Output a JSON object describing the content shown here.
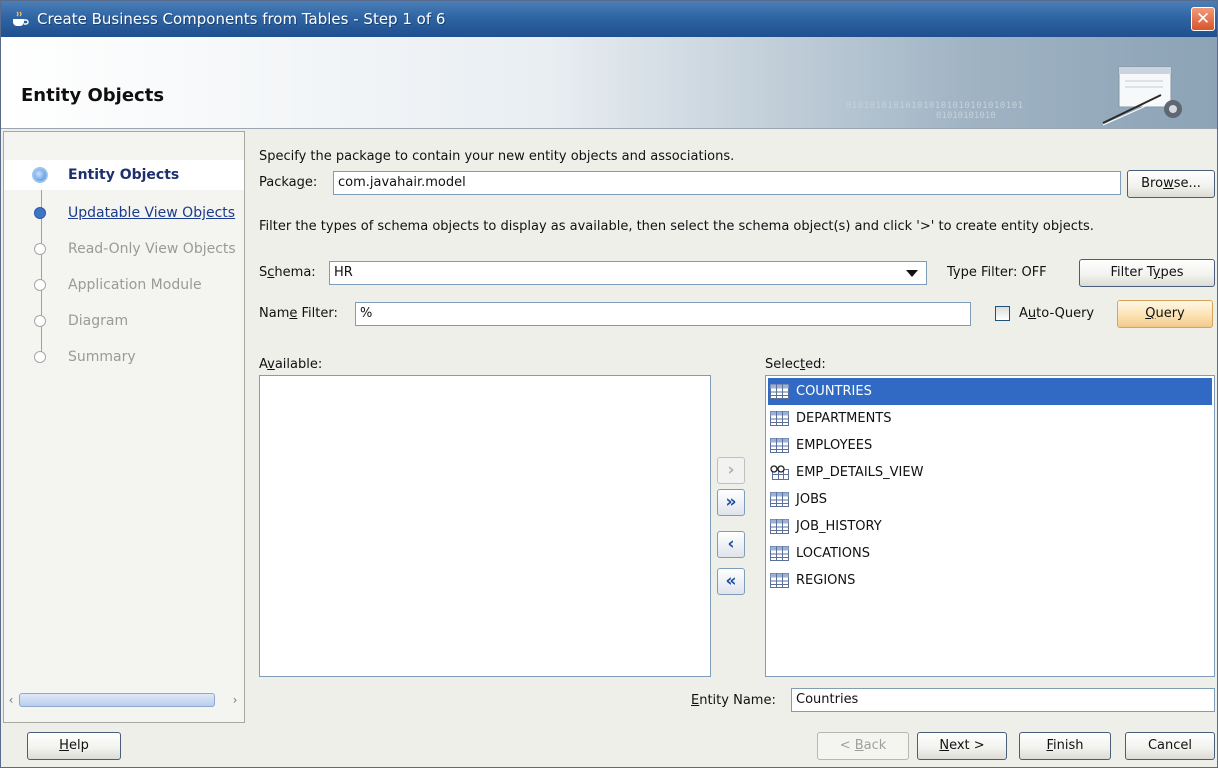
{
  "window": {
    "title": "Create Business Components from Tables - Step 1 of 6",
    "close_glyph": "✕"
  },
  "header": {
    "heading": "Entity Objects",
    "binary_line1": "010101010101010101010101010101",
    "binary_line2": "01010101010"
  },
  "nav": {
    "items": [
      {
        "label": "Entity Objects",
        "state": "active"
      },
      {
        "label": "Updatable View Objects",
        "state": "link"
      },
      {
        "label": "Read-Only View Objects",
        "state": "disabled"
      },
      {
        "label": "Application Module",
        "state": "disabled"
      },
      {
        "label": "Diagram",
        "state": "disabled"
      },
      {
        "label": "Summary",
        "state": "disabled"
      }
    ],
    "scroll_left": "‹",
    "scroll_right": "›"
  },
  "main": {
    "package_instruction": "Specify the package to contain your new entity objects and associations.",
    "package_label_pre": "Packa",
    "package_label_mn": "g",
    "package_label_post": "e:",
    "package_value": "com.javahair.model",
    "browse_pre": "Bro",
    "browse_mn": "w",
    "browse_post": "se...",
    "filter_instruction": "Filter the types of schema objects to display as available, then select the schema object(s) and click '>' to create entity objects.",
    "schema_label_pre": "S",
    "schema_label_mn": "c",
    "schema_label_post": "hema:",
    "schema_value": "HR",
    "type_filter_status": "Type Filter: OFF",
    "filter_types_pre": "Filter T",
    "filter_types_mn": "y",
    "filter_types_post": "pes",
    "name_filter_pre": "Nam",
    "name_filter_mn": "e",
    "name_filter_post": " Filter:",
    "name_filter_value": "%",
    "auto_query_pre": "A",
    "auto_query_mn": "u",
    "auto_query_post": "to-Query",
    "auto_query_checked": false,
    "query_mn": "Q",
    "query_post": "uery",
    "available_pre": "A",
    "available_mn": "v",
    "available_post": "ailable:",
    "selected_pre": "Selec",
    "selected_mn": "t",
    "selected_post": "ed:",
    "selected_items": [
      {
        "name": "COUNTRIES",
        "icon": "table-icon",
        "selected": true
      },
      {
        "name": "DEPARTMENTS",
        "icon": "table-icon",
        "selected": false
      },
      {
        "name": "EMPLOYEES",
        "icon": "table-icon",
        "selected": false
      },
      {
        "name": "EMP_DETAILS_VIEW",
        "icon": "view-icon",
        "selected": false
      },
      {
        "name": "JOBS",
        "icon": "table-icon",
        "selected": false
      },
      {
        "name": "JOB_HISTORY",
        "icon": "table-icon",
        "selected": false
      },
      {
        "name": "LOCATIONS",
        "icon": "table-icon",
        "selected": false
      },
      {
        "name": "REGIONS",
        "icon": "table-icon",
        "selected": false
      }
    ],
    "shuttle": {
      "add": "›",
      "add_all": "»",
      "remove": "‹",
      "remove_all": "«"
    },
    "entity_name_pre": "",
    "entity_name_mn": "E",
    "entity_name_post": "ntity Name:",
    "entity_name_value": "Countries"
  },
  "footer": {
    "help_mn": "H",
    "help_post": "elp",
    "back_pre": "< ",
    "back_mn": "B",
    "back_post": "ack",
    "next_mn": "N",
    "next_post": "ext >",
    "finish_mn": "F",
    "finish_post": "inish",
    "cancel": "Cancel"
  },
  "colors": {
    "selection": "#316ac5",
    "title_bar": "#2f65a4",
    "close_button": "#d9532b"
  }
}
